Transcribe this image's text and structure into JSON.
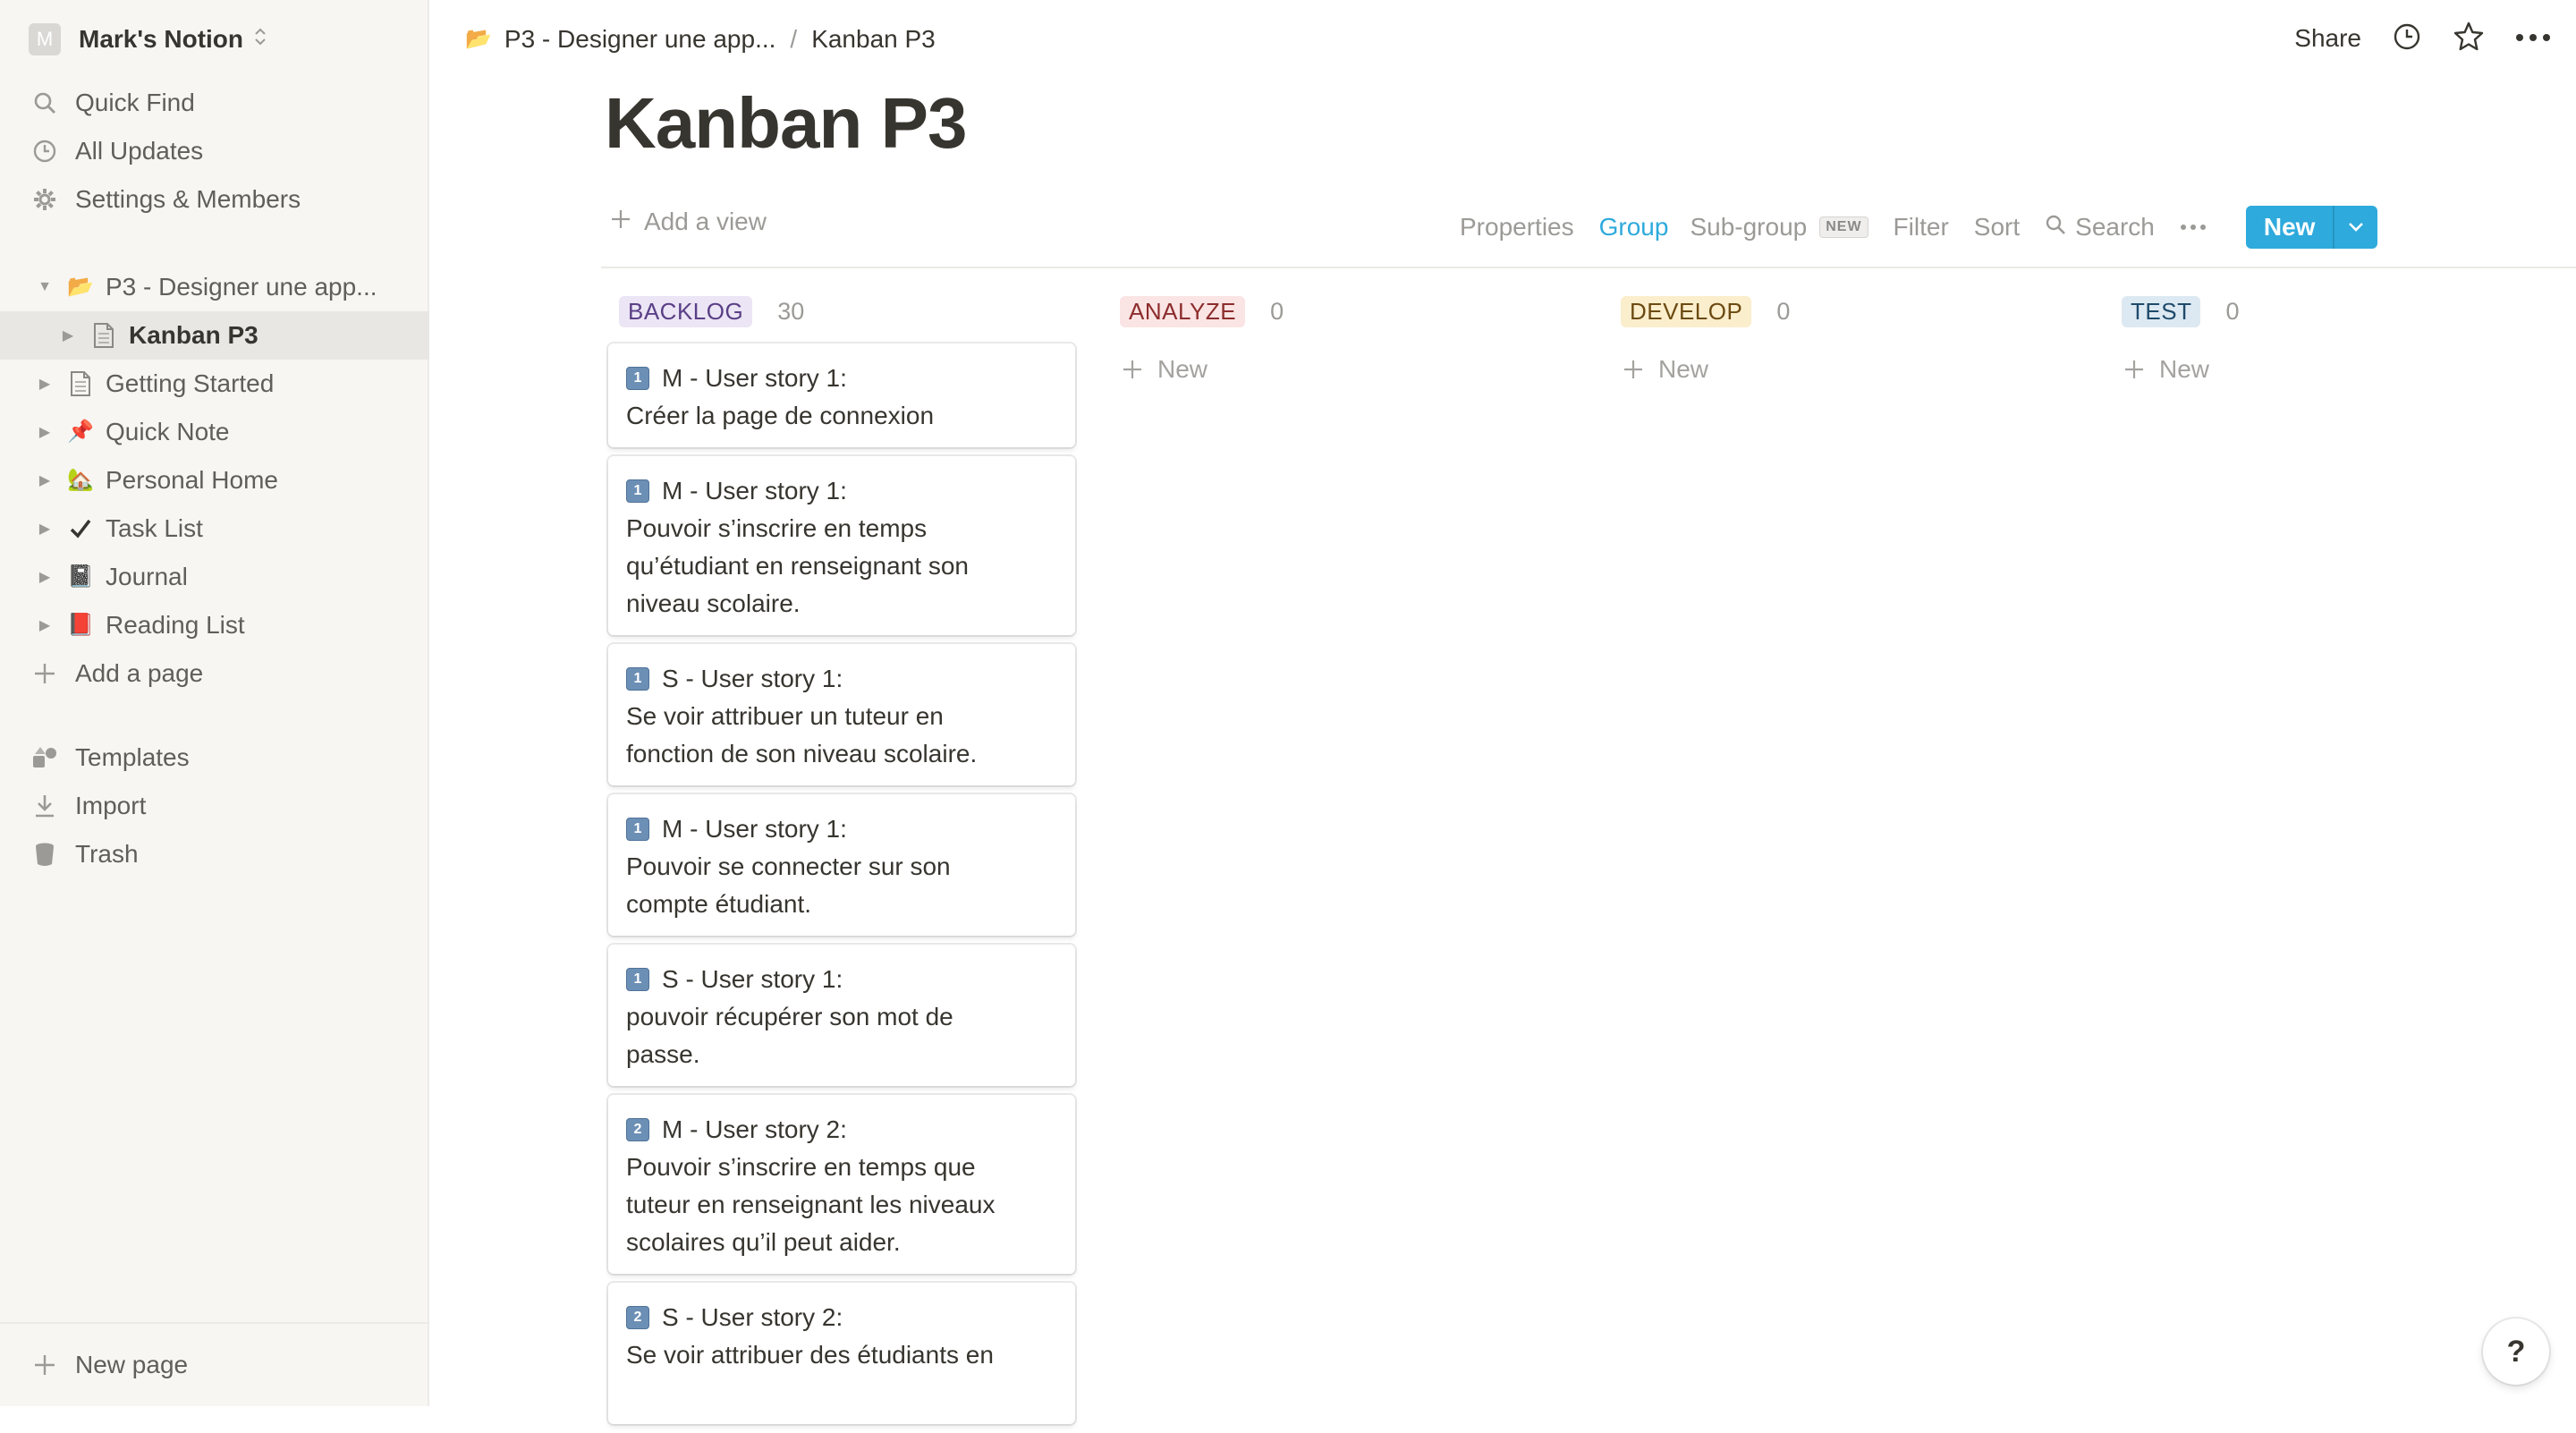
{
  "sidebar": {
    "workspace_initial": "M",
    "workspace_name": "Mark's Notion",
    "nav": [
      {
        "label": "Quick Find",
        "icon": "search-icon"
      },
      {
        "label": "All Updates",
        "icon": "clock-icon"
      },
      {
        "label": "Settings & Members",
        "icon": "gear-icon"
      }
    ],
    "pages": [
      {
        "label": "P3 - Designer une app...",
        "emoji": "📂",
        "expanded": true
      },
      {
        "label": "Kanban P3",
        "emoji": "",
        "active": true
      },
      {
        "label": "Getting Started",
        "emoji": ""
      },
      {
        "label": "Quick Note",
        "emoji": "📌"
      },
      {
        "label": "Personal Home",
        "emoji": "🏡"
      },
      {
        "label": "Task List",
        "emoji": "✔️"
      },
      {
        "label": "Journal",
        "emoji": "📓"
      },
      {
        "label": "Reading List",
        "emoji": "📕"
      }
    ],
    "add_page": "Add a page",
    "tools": [
      {
        "label": "Templates",
        "icon": "templates-icon"
      },
      {
        "label": "Import",
        "icon": "import-icon"
      },
      {
        "label": "Trash",
        "icon": "trash-icon"
      }
    ],
    "new_page": "New page"
  },
  "topbar": {
    "breadcrumb": [
      "P3 - Designer une app...",
      "Kanban P3"
    ],
    "breadcrumb_sep": "/",
    "share": "Share"
  },
  "page": {
    "title": "Kanban P3",
    "add_view": "Add a view",
    "toolbar": {
      "properties": "Properties",
      "group": "Group",
      "subgroup": "Sub-group",
      "subgroup_badge": "NEW",
      "filter": "Filter",
      "sort": "Sort",
      "search": "Search",
      "new_button": "New"
    }
  },
  "board": {
    "columns": [
      {
        "name": "BACKLOG",
        "count": "30",
        "bg": "#ebe5f5",
        "fg": "#5a3f86"
      },
      {
        "name": "ANALYZE",
        "count": "0",
        "bg": "#fbe4e4",
        "fg": "#8c2d2d"
      },
      {
        "name": "DEVELOP",
        "count": "0",
        "bg": "#fbeecc",
        "fg": "#6b4a12"
      },
      {
        "name": "TEST",
        "count": "0",
        "bg": "#dde9f2",
        "fg": "#1f4a6b"
      }
    ],
    "new_label": "New",
    "cards": [
      {
        "num": "1",
        "title": "M - User story 1:",
        "lines": [
          "Créer la page de connexion"
        ]
      },
      {
        "num": "1",
        "title": "M - User story 1:",
        "lines": [
          "Pouvoir s’inscrire en temps",
          "qu’étudiant en renseignant son",
          "niveau scolaire."
        ]
      },
      {
        "num": "1",
        "title": "S - User story 1:",
        "lines": [
          "Se voir attribuer un tuteur en",
          "fonction de son niveau scolaire."
        ]
      },
      {
        "num": "1",
        "title": "M - User story 1:",
        "lines": [
          "Pouvoir se connecter sur son",
          "compte étudiant."
        ]
      },
      {
        "num": "1",
        "title": "S - User story 1:",
        "lines": [
          "pouvoir récupérer son mot de",
          "passe."
        ]
      },
      {
        "num": "2",
        "title": "M - User story 2:",
        "lines": [
          "Pouvoir s’inscrire en temps que",
          "tuteur en renseignant les niveaux",
          "scolaires qu’il peut aider."
        ]
      },
      {
        "num": "2",
        "title": "S - User story 2:",
        "lines": [
          "Se voir attribuer des étudiants en",
          ""
        ]
      }
    ]
  },
  "help": "?"
}
